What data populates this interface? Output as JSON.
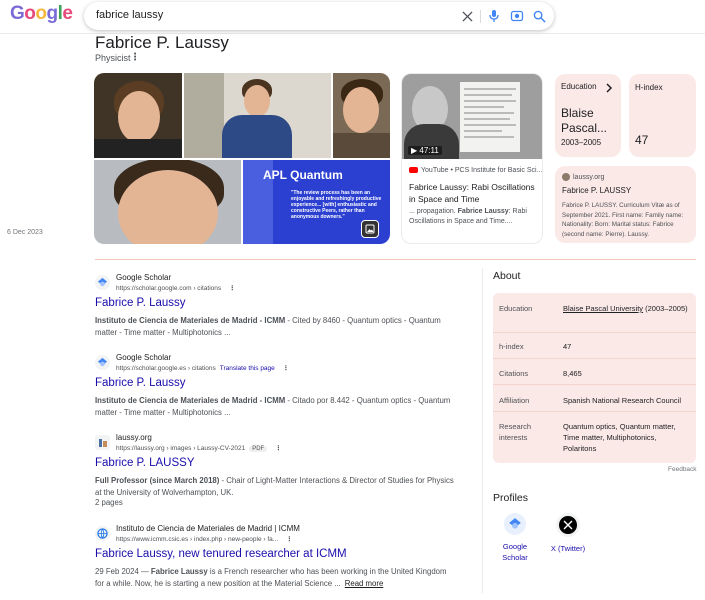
{
  "search": {
    "logo": "Google",
    "query": "fabrice laussy",
    "logo_colors": [
      "#7b6bd6",
      "#e64a7b",
      "#f6b73c",
      "#7b6bd6",
      "#42a25a",
      "#e64a7b"
    ]
  },
  "entity": {
    "name": "Fabrice P. Laussy",
    "type": "Physicist"
  },
  "images": {
    "apl_title": "APL Quantum",
    "apl_quote": "\"The review process has been an enjoyable and refreshingly productive experience... [with] enthusiastic and constructive Peers, rather than anonymous downers.\""
  },
  "video": {
    "duration": "47:11",
    "source": "YouTube • PCS Institute for Basic Sci...",
    "title": "Fabrice Laussy: Rabi Oscillations in Space and Time",
    "snippet_prefix": "... propagation. ",
    "snippet_bold": "Fabrice Laussy",
    "snippet_suffix": ": Rabi Oscillations in Space and Time....",
    "date": "6 Dec 2023"
  },
  "cards": {
    "education_label": "Education",
    "education_value": "Blaise Pascal...",
    "education_years": "2003–2005",
    "hindex_label": "H-index",
    "hindex_value": "47"
  },
  "source_card": {
    "site": "laussy.org",
    "title": "Fabrice P. LAUSSY",
    "snippet": "Fabrice P. LAUSSY. Curriculum Vitæ as of September 2021. First name: Family name: Nationality: Born: Marital status: Fabrice (second name: Pierre). Laussy."
  },
  "results": [
    {
      "site": "Google Scholar",
      "url": "https://scholar.google.com › citations",
      "title": "Fabrice P. Laussy",
      "snippet_bold": "Instituto de Ciencia de Materiales de Madrid - ICMM",
      "snippet": " - Cited by 8460 - Quantum optics - Quantum matter - Time matter - Multiphotonics ..."
    },
    {
      "site": "Google Scholar",
      "url": "https://scholar.google.es › citations",
      "translate": "Translate this page",
      "title": "Fabrice P. Laussy",
      "snippet_bold": "Instituto de Ciencia de Materiales de Madrid - ICMM",
      "snippet": " - Citado por 8.442 - Quantum optics - Quantum matter - Time matter - Multiphotonics ..."
    },
    {
      "site": "laussy.org",
      "url": "https://laussy.org › images › Laussy-CV-2021",
      "badge": "PDF",
      "title": "Fabrice P. LAUSSY",
      "snippet_bold": "Full Professor (since March 2018)",
      "snippet": " - Chair of Light-Matter Interactions & Director of Studies for Physics at the University of Wolverhampton, UK.",
      "pages": "2 pages"
    },
    {
      "site": "Instituto de Ciencia de Materiales de Madrid | ICMM",
      "url": "https://www.icmm.csic.es › index.php › new-people › fa...",
      "title": "Fabrice Laussy, new tenured researcher at ICMM",
      "date": "29 Feb 2024 — ",
      "snippet_bold": "Fabrice Laussy",
      "snippet": " is a French researcher who has been working in the United Kingdom for a while. Now, he is starting a new position at the Material Science ...",
      "read_more": "Read more"
    }
  ],
  "about": {
    "heading": "About",
    "rows": [
      {
        "key": "Education",
        "value_link": "Blaise Pascal University",
        "value": " (2003–2005)"
      },
      {
        "key": "h-index",
        "value": "47"
      },
      {
        "key": "Citations",
        "value": "8,465"
      },
      {
        "key": "Affiliation",
        "value": "Spanish National Research Council"
      },
      {
        "key": "Research interests",
        "value": "Quantum optics, Quantum matter, Time matter, Multiphotonics, Polaritons"
      }
    ],
    "feedback": "Feedback"
  },
  "profiles": {
    "heading": "Profiles",
    "items": [
      {
        "label": "Google Scholar"
      },
      {
        "label": "X (Twitter)"
      }
    ]
  },
  "colors": {
    "link": "#1a0dab",
    "card_bg": "#fbe9e7",
    "separator": "#f3c4b8"
  }
}
